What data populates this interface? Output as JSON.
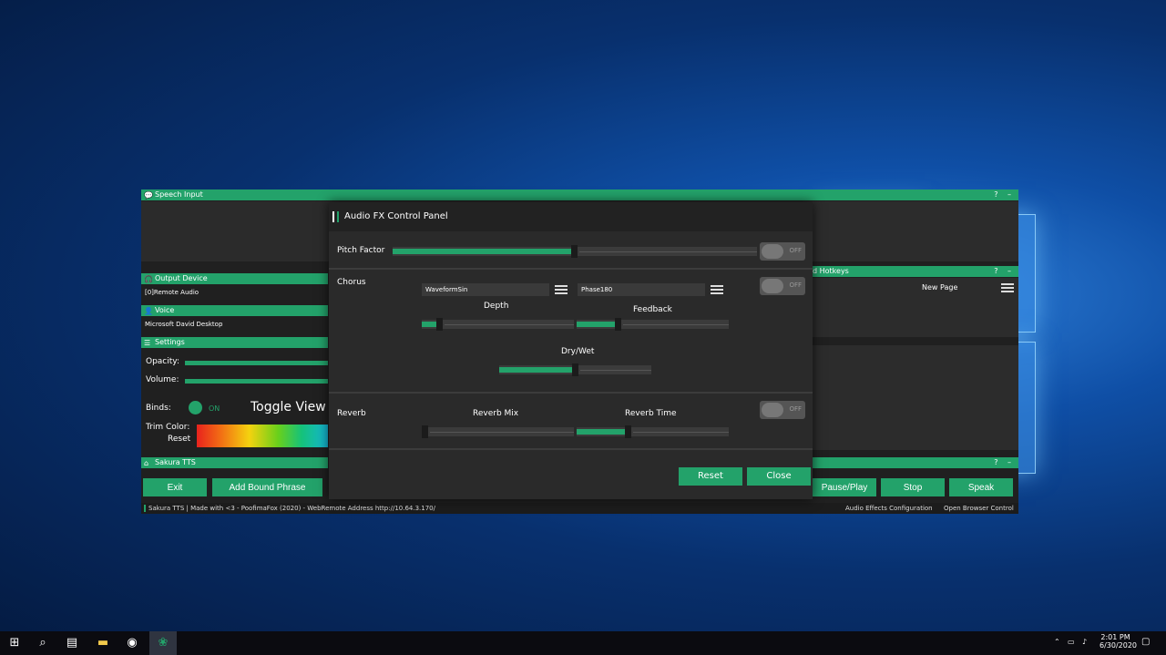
{
  "app": {
    "speech_input": {
      "title": "Speech Input",
      "controls": "? –"
    },
    "output_device": {
      "title": "Output Device",
      "value": "[0]Remote Audio"
    },
    "voice": {
      "title": "Voice",
      "value": "Microsoft David Desktop"
    },
    "settings": {
      "title": "Settings",
      "opacity_label": "Opacity:",
      "volume_label": "Volume:",
      "binds_label": "Binds:",
      "binds_state": "ON",
      "toggle_view_label": "Toggle View K",
      "trim_color_label": "Trim Color:",
      "reset_label": "Reset"
    },
    "sakura": {
      "title": "Sakura TTS",
      "controls": "? –"
    },
    "hotkeys": {
      "title": "d Hotkeys",
      "controls": "? –",
      "page_label": "New Page"
    },
    "buttons": {
      "exit": "Exit",
      "add_bound_phrase": "Add Bound Phrase",
      "pause_play": "Pause/Play",
      "stop": "Stop",
      "speak": "Speak"
    },
    "status": {
      "left": "Sakura TTS | Made with <3 - PoofimaFox (2020) - WebRemote Address http://10.64.3.170/",
      "audio_fx": "Audio Effects Configuration",
      "browser": "Open Browser Control"
    }
  },
  "fx_panel": {
    "title": "Audio FX Control Panel",
    "pitch": {
      "label": "Pitch Factor",
      "value": 0.49,
      "toggle": "OFF"
    },
    "chorus": {
      "label": "Chorus",
      "waveform": "WaveformSin",
      "phase": "Phase180",
      "toggle": "OFF",
      "depth_label": "Depth",
      "depth_value": 0.1,
      "feedback_label": "Feedback",
      "feedback_value": 0.25,
      "drywet_label": "Dry/Wet",
      "drywet_value": 0.48
    },
    "reverb": {
      "label": "Reverb",
      "toggle": "OFF",
      "mix_label": "Reverb Mix",
      "mix_value": 0.0,
      "time_label": "Reverb Time",
      "time_value": 0.33
    },
    "reset": "Reset",
    "close": "Close"
  },
  "taskbar": {
    "time": "2:01 PM",
    "date": "6/30/2020"
  },
  "colors": {
    "accent": "#23a26a",
    "panel": "#2a2a2a"
  }
}
